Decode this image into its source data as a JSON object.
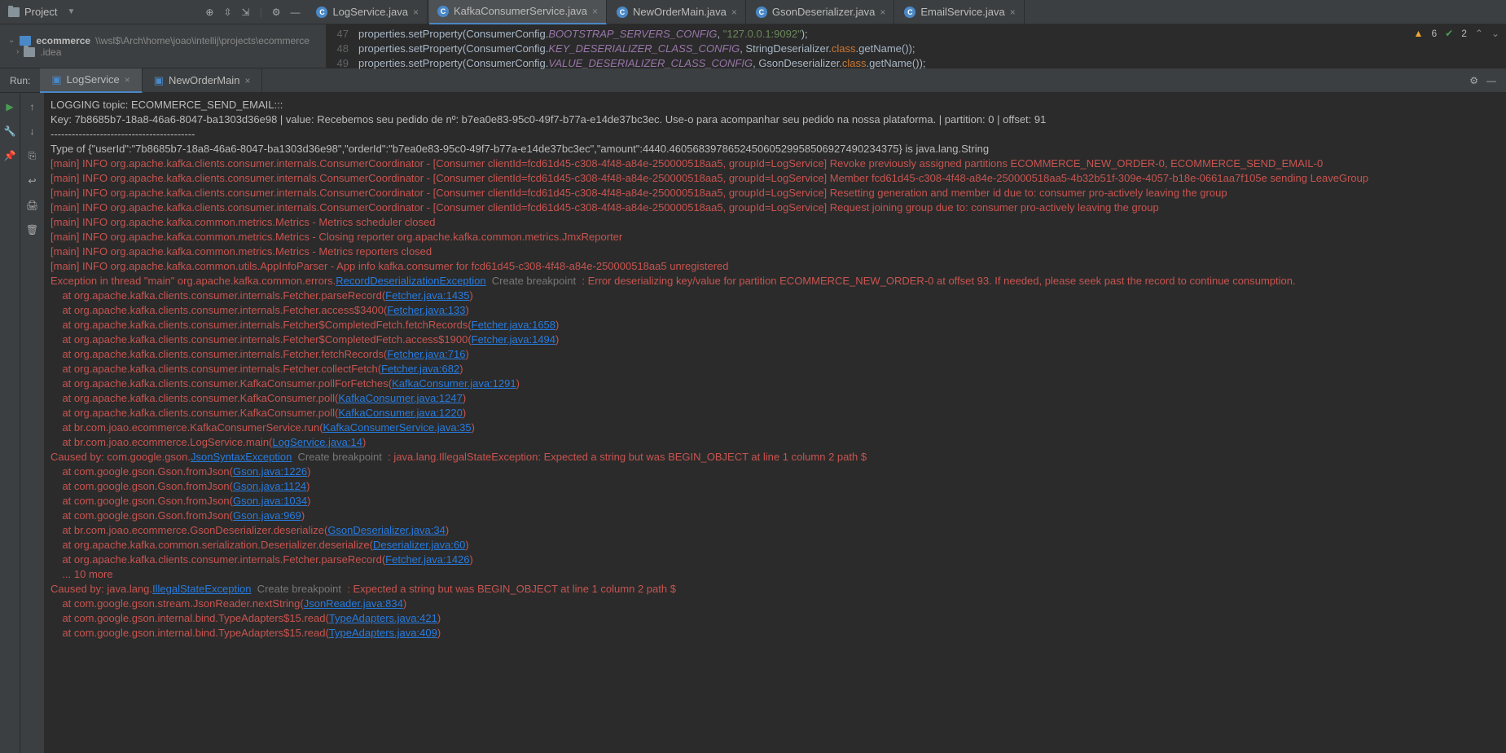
{
  "project": {
    "label": "Project",
    "breadcrumb_root": "ecommerce",
    "breadcrumb_path": "\\\\wsl$\\Arch\\home\\joao\\intellij\\projects\\ecommerce",
    "idea_folder": ".idea"
  },
  "editorTabs": [
    {
      "label": "LogService.java",
      "active": false
    },
    {
      "label": "KafkaConsumerService.java",
      "active": true
    },
    {
      "label": "NewOrderMain.java",
      "active": false
    },
    {
      "label": "GsonDeserializer.java",
      "active": false
    },
    {
      "label": "EmailService.java",
      "active": false
    }
  ],
  "codeLines": [
    {
      "n": "47",
      "pre": "            properties.setProperty(ConsumerConfig.",
      "const": "BOOTSTRAP_SERVERS_CONFIG",
      "mid": ", ",
      "str": "\"127.0.0.1:9092\"",
      "post": ");"
    },
    {
      "n": "48",
      "pre": "            properties.setProperty(ConsumerConfig.",
      "const": "KEY_DESERIALIZER_CLASS_CONFIG",
      "mid": ", StringDeserializer.",
      "kw": "class",
      "post": ".getName());"
    },
    {
      "n": "49",
      "pre": "            properties.setProperty(ConsumerConfig.",
      "const": "VALUE_DESERIALIZER_CLASS_CONFIG",
      "mid": ", GsonDeserializer.",
      "kw": "class",
      "post": ".getName());"
    }
  ],
  "status": {
    "warn": "6",
    "check": "2"
  },
  "run": {
    "label": "Run:",
    "tabs": [
      {
        "label": "LogService",
        "active": true
      },
      {
        "label": "NewOrderMain",
        "active": false
      }
    ]
  },
  "console": [
    {
      "cls": "c-white",
      "text": "LOGGING topic: ECOMMERCE_SEND_EMAIL:::"
    },
    {
      "cls": "c-white",
      "text": "Key: 7b8685b7-18a8-46a6-8047-ba1303d36e98 | value: Recebemos seu pedido de nº: b7ea0e83-95c0-49f7-b77a-e14de37bc3ec. Use-o para acompanhar seu pedido na nossa plataforma. | partition: 0 | offset: 91"
    },
    {
      "cls": "c-white",
      "text": "-----------------------------------------"
    },
    {
      "cls": "c-white",
      "text": "Type of {\"userId\":\"7b8685b7-18a8-46a6-8047-ba1303d36e98\",\"orderId\":\"b7ea0e83-95c0-49f7-b77a-e14de37bc3ec\",\"amount\":4440.460568397865245060529958506927490234375} is java.lang.String"
    },
    {
      "cls": "c-red",
      "text": "[main] INFO org.apache.kafka.clients.consumer.internals.ConsumerCoordinator - [Consumer clientId=fcd61d45-c308-4f48-a84e-250000518aa5, groupId=LogService] Revoke previously assigned partitions ECOMMERCE_NEW_ORDER-0, ECOMMERCE_SEND_EMAIL-0"
    },
    {
      "cls": "c-red",
      "text": "[main] INFO org.apache.kafka.clients.consumer.internals.ConsumerCoordinator - [Consumer clientId=fcd61d45-c308-4f48-a84e-250000518aa5, groupId=LogService] Member fcd61d45-c308-4f48-a84e-250000518aa5-4b32b51f-309e-4057-b18e-0661aa7f105e sending LeaveGroup"
    },
    {
      "cls": "c-red",
      "text": "[main] INFO org.apache.kafka.clients.consumer.internals.ConsumerCoordinator - [Consumer clientId=fcd61d45-c308-4f48-a84e-250000518aa5, groupId=LogService] Resetting generation and member id due to: consumer pro-actively leaving the group"
    },
    {
      "cls": "c-red",
      "text": "[main] INFO org.apache.kafka.clients.consumer.internals.ConsumerCoordinator - [Consumer clientId=fcd61d45-c308-4f48-a84e-250000518aa5, groupId=LogService] Request joining group due to: consumer pro-actively leaving the group"
    },
    {
      "cls": "c-red",
      "text": "[main] INFO org.apache.kafka.common.metrics.Metrics - Metrics scheduler closed"
    },
    {
      "cls": "c-red",
      "text": "[main] INFO org.apache.kafka.common.metrics.Metrics - Closing reporter org.apache.kafka.common.metrics.JmxReporter"
    },
    {
      "cls": "c-red",
      "text": "[main] INFO org.apache.kafka.common.metrics.Metrics - Metrics reporters closed"
    },
    {
      "cls": "c-red",
      "text": "[main] INFO org.apache.kafka.common.utils.AppInfoParser - App info kafka.consumer for fcd61d45-c308-4f48-a84e-250000518aa5 unregistered"
    },
    {
      "segments": [
        {
          "cls": "c-red",
          "t": "Exception in thread \"main\" org.apache.kafka.common.errors."
        },
        {
          "cls": "c-link",
          "t": "RecordDeserializationException"
        },
        {
          "cls": "c-gray",
          "t": "  Create breakpoint "
        },
        {
          "cls": "c-red",
          "t": " : Error deserializing key/value for partition ECOMMERCE_NEW_ORDER-0 at offset 93. If needed, please seek past the record to continue consumption."
        }
      ]
    },
    {
      "segments": [
        {
          "cls": "c-red",
          "t": "    at org.apache.kafka.clients.consumer.internals.Fetcher.parseRecord("
        },
        {
          "cls": "c-link",
          "t": "Fetcher.java:1435"
        },
        {
          "cls": "c-red",
          "t": ")"
        }
      ]
    },
    {
      "segments": [
        {
          "cls": "c-red",
          "t": "    at org.apache.kafka.clients.consumer.internals.Fetcher.access$3400("
        },
        {
          "cls": "c-link",
          "t": "Fetcher.java:133"
        },
        {
          "cls": "c-red",
          "t": ")"
        }
      ]
    },
    {
      "segments": [
        {
          "cls": "c-red",
          "t": "    at org.apache.kafka.clients.consumer.internals.Fetcher$CompletedFetch.fetchRecords("
        },
        {
          "cls": "c-link",
          "t": "Fetcher.java:1658"
        },
        {
          "cls": "c-red",
          "t": ")"
        }
      ]
    },
    {
      "segments": [
        {
          "cls": "c-red",
          "t": "    at org.apache.kafka.clients.consumer.internals.Fetcher$CompletedFetch.access$1900("
        },
        {
          "cls": "c-link",
          "t": "Fetcher.java:1494"
        },
        {
          "cls": "c-red",
          "t": ")"
        }
      ]
    },
    {
      "segments": [
        {
          "cls": "c-red",
          "t": "    at org.apache.kafka.clients.consumer.internals.Fetcher.fetchRecords("
        },
        {
          "cls": "c-link",
          "t": "Fetcher.java:716"
        },
        {
          "cls": "c-red",
          "t": ")"
        }
      ]
    },
    {
      "segments": [
        {
          "cls": "c-red",
          "t": "    at org.apache.kafka.clients.consumer.internals.Fetcher.collectFetch("
        },
        {
          "cls": "c-link",
          "t": "Fetcher.java:682"
        },
        {
          "cls": "c-red",
          "t": ")"
        }
      ]
    },
    {
      "segments": [
        {
          "cls": "c-red",
          "t": "    at org.apache.kafka.clients.consumer.KafkaConsumer.pollForFetches("
        },
        {
          "cls": "c-link",
          "t": "KafkaConsumer.java:1291"
        },
        {
          "cls": "c-red",
          "t": ")"
        }
      ]
    },
    {
      "segments": [
        {
          "cls": "c-red",
          "t": "    at org.apache.kafka.clients.consumer.KafkaConsumer.poll("
        },
        {
          "cls": "c-link",
          "t": "KafkaConsumer.java:1247"
        },
        {
          "cls": "c-red",
          "t": ")"
        }
      ]
    },
    {
      "segments": [
        {
          "cls": "c-red",
          "t": "    at org.apache.kafka.clients.consumer.KafkaConsumer.poll("
        },
        {
          "cls": "c-link",
          "t": "KafkaConsumer.java:1220"
        },
        {
          "cls": "c-red",
          "t": ")"
        }
      ]
    },
    {
      "segments": [
        {
          "cls": "c-red",
          "t": "    at br.com.joao.ecommerce.KafkaConsumerService.run("
        },
        {
          "cls": "c-link",
          "t": "KafkaConsumerService.java:35"
        },
        {
          "cls": "c-red",
          "t": ")"
        }
      ]
    },
    {
      "segments": [
        {
          "cls": "c-red",
          "t": "    at br.com.joao.ecommerce.LogService.main("
        },
        {
          "cls": "c-link",
          "t": "LogService.java:14"
        },
        {
          "cls": "c-red",
          "t": ")"
        }
      ]
    },
    {
      "segments": [
        {
          "cls": "c-red",
          "t": "Caused by: com.google.gson."
        },
        {
          "cls": "c-link",
          "t": "JsonSyntaxException"
        },
        {
          "cls": "c-gray",
          "t": "  Create breakpoint "
        },
        {
          "cls": "c-red",
          "t": " : java.lang.IllegalStateException: Expected a string but was BEGIN_OBJECT at line 1 column 2 path $"
        }
      ]
    },
    {
      "segments": [
        {
          "cls": "c-red",
          "t": "    at com.google.gson.Gson.fromJson("
        },
        {
          "cls": "c-link",
          "t": "Gson.java:1226"
        },
        {
          "cls": "c-red",
          "t": ")"
        }
      ]
    },
    {
      "segments": [
        {
          "cls": "c-red",
          "t": "    at com.google.gson.Gson.fromJson("
        },
        {
          "cls": "c-link",
          "t": "Gson.java:1124"
        },
        {
          "cls": "c-red",
          "t": ")"
        }
      ]
    },
    {
      "segments": [
        {
          "cls": "c-red",
          "t": "    at com.google.gson.Gson.fromJson("
        },
        {
          "cls": "c-link",
          "t": "Gson.java:1034"
        },
        {
          "cls": "c-red",
          "t": ")"
        }
      ]
    },
    {
      "segments": [
        {
          "cls": "c-red",
          "t": "    at com.google.gson.Gson.fromJson("
        },
        {
          "cls": "c-link",
          "t": "Gson.java:969"
        },
        {
          "cls": "c-red",
          "t": ")"
        }
      ]
    },
    {
      "segments": [
        {
          "cls": "c-red",
          "t": "    at br.com.joao.ecommerce.GsonDeserializer.deserialize("
        },
        {
          "cls": "c-link",
          "t": "GsonDeserializer.java:34"
        },
        {
          "cls": "c-red",
          "t": ")"
        }
      ]
    },
    {
      "segments": [
        {
          "cls": "c-red",
          "t": "    at org.apache.kafka.common.serialization.Deserializer.deserialize("
        },
        {
          "cls": "c-link",
          "t": "Deserializer.java:60"
        },
        {
          "cls": "c-red",
          "t": ")"
        }
      ]
    },
    {
      "segments": [
        {
          "cls": "c-red",
          "t": "    at org.apache.kafka.clients.consumer.internals.Fetcher.parseRecord("
        },
        {
          "cls": "c-link",
          "t": "Fetcher.java:1426"
        },
        {
          "cls": "c-red",
          "t": ")"
        }
      ]
    },
    {
      "cls": "c-red",
      "text": "    ... 10 more"
    },
    {
      "segments": [
        {
          "cls": "c-red",
          "t": "Caused by: java.lang."
        },
        {
          "cls": "c-link",
          "t": "IllegalStateException"
        },
        {
          "cls": "c-gray",
          "t": "  Create breakpoint "
        },
        {
          "cls": "c-red",
          "t": " : Expected a string but was BEGIN_OBJECT at line 1 column 2 path $"
        }
      ]
    },
    {
      "segments": [
        {
          "cls": "c-red",
          "t": "    at com.google.gson.stream.JsonReader.nextString("
        },
        {
          "cls": "c-link",
          "t": "JsonReader.java:834"
        },
        {
          "cls": "c-red",
          "t": ")"
        }
      ]
    },
    {
      "segments": [
        {
          "cls": "c-red",
          "t": "    at com.google.gson.internal.bind.TypeAdapters$15.read("
        },
        {
          "cls": "c-link",
          "t": "TypeAdapters.java:421"
        },
        {
          "cls": "c-red",
          "t": ")"
        }
      ]
    },
    {
      "segments": [
        {
          "cls": "c-red",
          "t": "    at com.google.gson.internal.bind.TypeAdapters$15.read("
        },
        {
          "cls": "c-link",
          "t": "TypeAdapters.java:409"
        },
        {
          "cls": "c-red",
          "t": ")"
        }
      ]
    }
  ]
}
